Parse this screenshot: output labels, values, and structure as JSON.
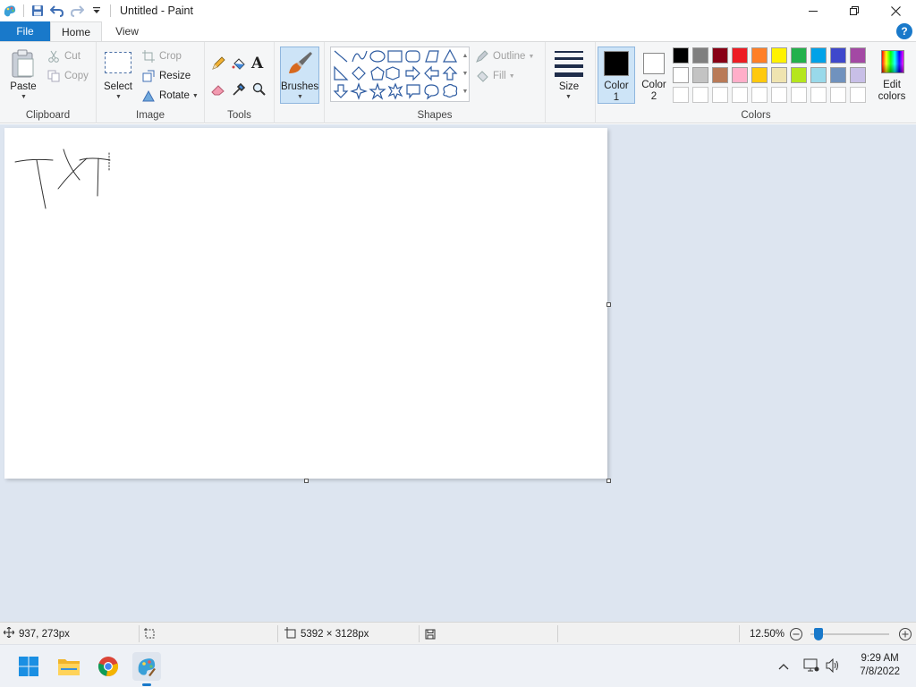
{
  "window": {
    "title": "Untitled - Paint",
    "quick_access": [
      "paint-app-icon",
      "save-icon",
      "undo-icon",
      "redo-icon",
      "customize-dropdown-icon"
    ]
  },
  "tabs": [
    {
      "label": "File",
      "active": false
    },
    {
      "label": "Home",
      "active": true
    },
    {
      "label": "View",
      "active": false
    }
  ],
  "help": "?",
  "ribbon": {
    "clipboard": {
      "label": "Clipboard",
      "paste": "Paste",
      "cut": "Cut",
      "copy": "Copy"
    },
    "image": {
      "label": "Image",
      "select": "Select",
      "crop": "Crop",
      "resize": "Resize",
      "rotate": "Rotate"
    },
    "tools": {
      "label": "Tools"
    },
    "brushes": {
      "label": "Brushes"
    },
    "shapes": {
      "label": "Shapes",
      "outline": "Outline",
      "fill": "Fill"
    },
    "size": {
      "label": "Size"
    },
    "colors": {
      "label": "Colors",
      "color1": "Color",
      "color1_num": "1",
      "color2": "Color",
      "color2_num": "2",
      "edit1": "Edit",
      "edit2": "colors",
      "color1_value": "#000000",
      "color2_value": "#ffffff",
      "palette_row1": [
        "#000000",
        "#7f7f7f",
        "#880015",
        "#ed1c24",
        "#ff7f27",
        "#fff200",
        "#22b14c",
        "#00a2e8",
        "#3f48cc",
        "#a349a4"
      ],
      "palette_row2": [
        "#ffffff",
        "#c3c3c3",
        "#b97a57",
        "#ffaec9",
        "#ffc90e",
        "#efe4b0",
        "#b5e61d",
        "#99d9ea",
        "#7092be",
        "#c8bfe7"
      ]
    }
  },
  "status": {
    "cursor_pos": "937, 273px",
    "canvas_size": "5392 × 3128px",
    "zoom": "12.50%",
    "zoom_level": 0.12
  },
  "taskbar": {
    "apps": [
      "start-icon",
      "file-explorer-icon",
      "chrome-icon",
      "paint-icon"
    ],
    "time": "9:29 AM",
    "date": "7/8/2022"
  }
}
